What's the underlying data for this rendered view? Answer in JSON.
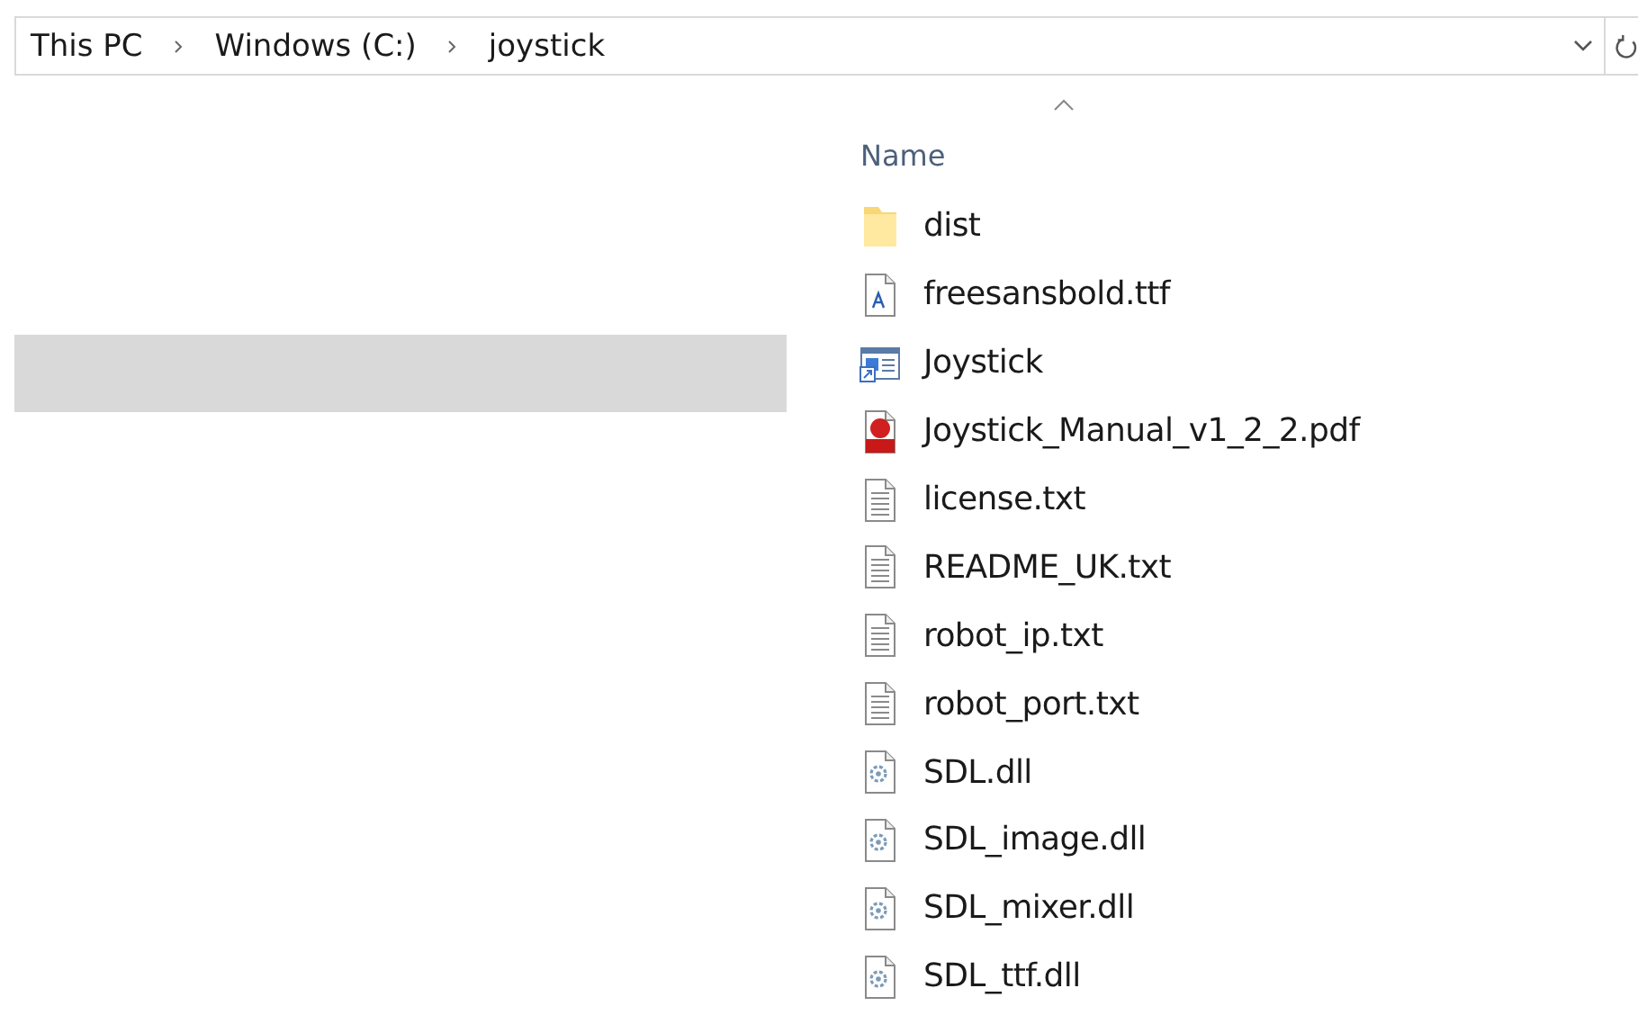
{
  "address_bar": {
    "crumbs": [
      {
        "label": "This PC"
      },
      {
        "label": "Windows (C:)"
      },
      {
        "label": "joystick"
      }
    ]
  },
  "nav_pane": {
    "items": [
      {
        "selected": true
      }
    ]
  },
  "file_list": {
    "column": {
      "label": "Name",
      "sort_ascending": true
    },
    "rows": [
      {
        "name": "dist",
        "kind": "folder"
      },
      {
        "name": "freesansbold.ttf",
        "kind": "font"
      },
      {
        "name": "Joystick",
        "kind": "shortcut"
      },
      {
        "name": "Joystick_Manual_v1_2_2.pdf",
        "kind": "pdf"
      },
      {
        "name": "license.txt",
        "kind": "text"
      },
      {
        "name": "README_UK.txt",
        "kind": "text"
      },
      {
        "name": "robot_ip.txt",
        "kind": "text"
      },
      {
        "name": "robot_port.txt",
        "kind": "text"
      },
      {
        "name": "SDL.dll",
        "kind": "dll"
      },
      {
        "name": "SDL_image.dll",
        "kind": "dll"
      },
      {
        "name": "SDL_mixer.dll",
        "kind": "dll"
      },
      {
        "name": "SDL_ttf.dll",
        "kind": "dll"
      }
    ]
  }
}
